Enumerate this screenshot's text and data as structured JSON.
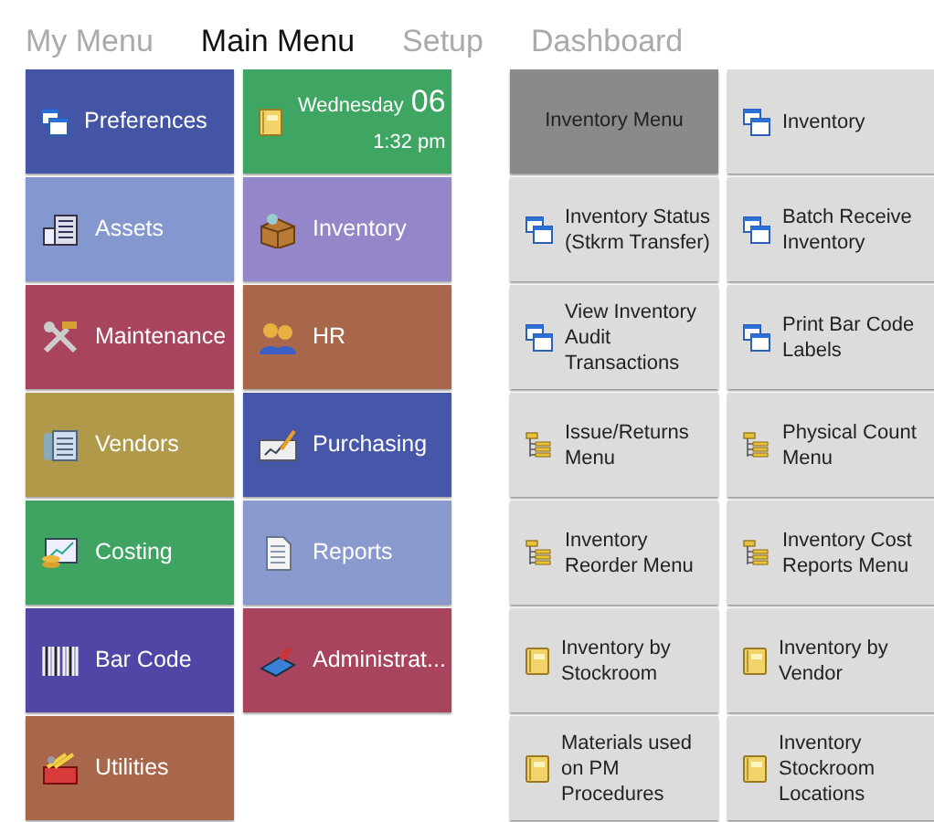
{
  "tabs": [
    {
      "label": "My Menu",
      "selected": false
    },
    {
      "label": "Main Menu",
      "selected": true
    },
    {
      "label": "Setup",
      "selected": false
    },
    {
      "label": "Dashboard",
      "selected": false
    }
  ],
  "tiles": [
    {
      "kind": "link",
      "label": "Preferences",
      "color": "#4455a6"
    },
    {
      "kind": "clock",
      "day": "Wednesday",
      "date": "06",
      "time": "1:32 pm",
      "color": "#3fa562"
    },
    {
      "kind": "link",
      "label": "Assets",
      "color": "#8497cf"
    },
    {
      "kind": "link",
      "label": "Inventory",
      "color": "#9486c9"
    },
    {
      "kind": "link",
      "label": "Maintenance",
      "color": "#a8445e"
    },
    {
      "kind": "link",
      "label": "HR",
      "color": "#a8664a"
    },
    {
      "kind": "link",
      "label": "Vendors",
      "color": "#b09a4a"
    },
    {
      "kind": "link",
      "label": "Purchasing",
      "color": "#4656a8"
    },
    {
      "kind": "link",
      "label": "Costing",
      "color": "#3fa462"
    },
    {
      "kind": "link",
      "label": "Reports",
      "color": "#8a9acf"
    },
    {
      "kind": "link",
      "label": "Bar Code",
      "color": "#5046a6"
    },
    {
      "kind": "link",
      "label": "Administrat...",
      "color": "#a8445e"
    },
    {
      "kind": "link",
      "label": "Utilities",
      "color": "#a8664a"
    }
  ],
  "submenu": [
    {
      "kind": "header",
      "label": "Inventory Menu"
    },
    {
      "kind": "form",
      "label": "Inventory"
    },
    {
      "kind": "form",
      "label": "Inventory Status (Stkrm Transfer)"
    },
    {
      "kind": "form",
      "label": "Batch Receive Inventory"
    },
    {
      "kind": "form",
      "label": "View Inventory Audit Transactions"
    },
    {
      "kind": "form",
      "label": "Print Bar Code Labels"
    },
    {
      "kind": "menu",
      "label": "Issue/Returns Menu"
    },
    {
      "kind": "menu",
      "label": "Physical Count Menu"
    },
    {
      "kind": "menu",
      "label": "Inventory Reorder Menu"
    },
    {
      "kind": "menu",
      "label": "Inventory Cost Reports Menu"
    },
    {
      "kind": "report",
      "label": "Inventory by Stockroom"
    },
    {
      "kind": "report",
      "label": "Inventory by Vendor"
    },
    {
      "kind": "report",
      "label": "Materials used on PM Procedures"
    },
    {
      "kind": "report",
      "label": "Inventory Stockroom Locations"
    }
  ]
}
